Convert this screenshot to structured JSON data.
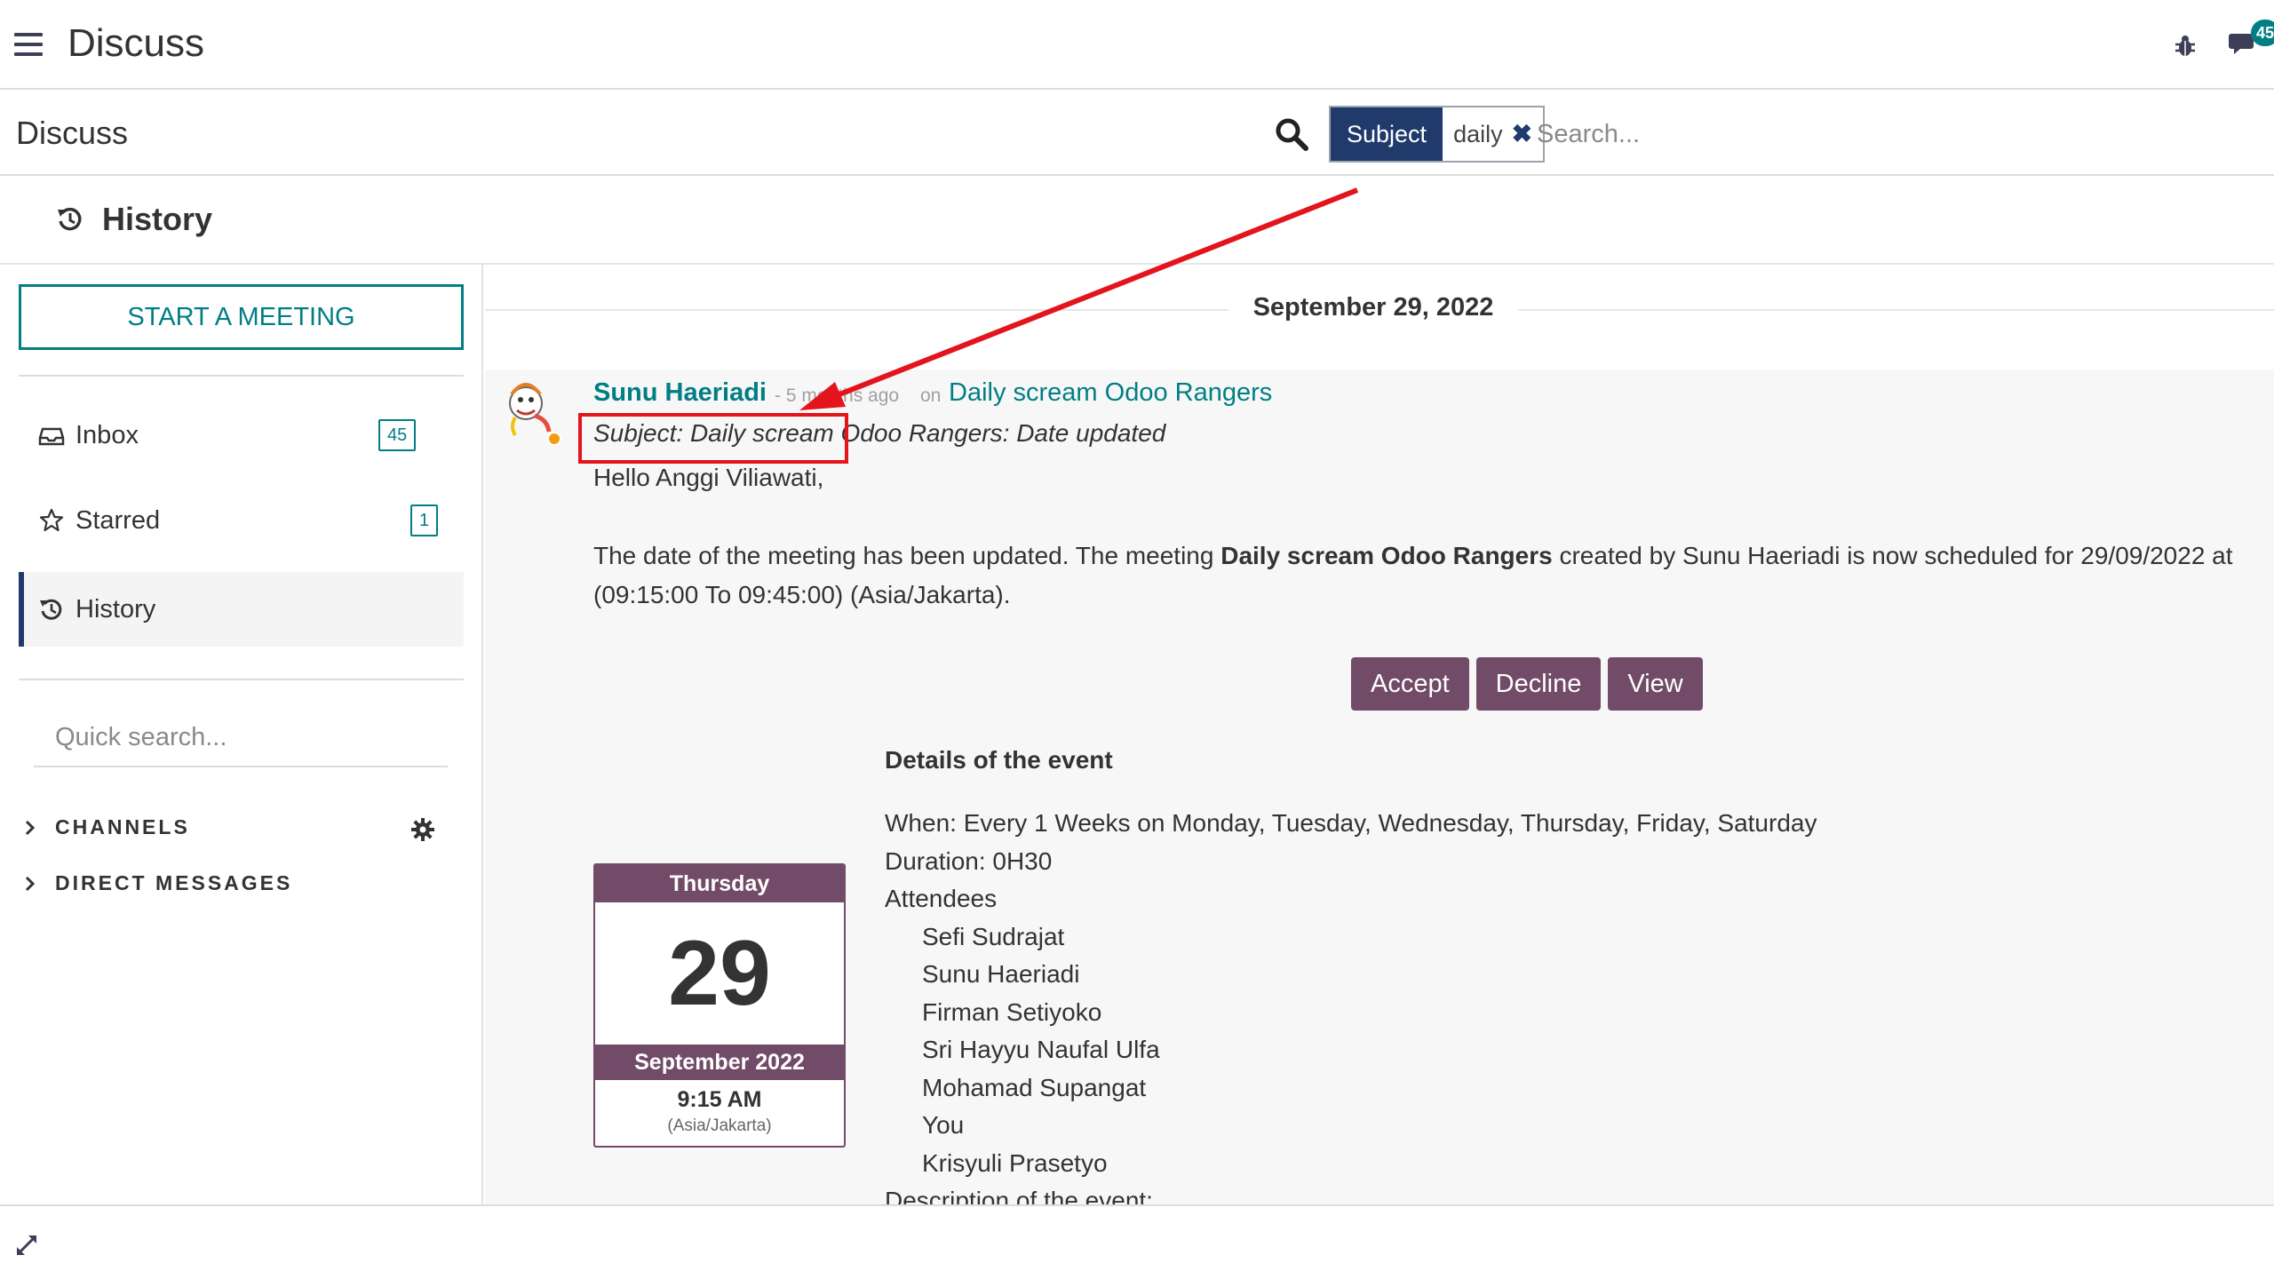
{
  "app": {
    "title": "Discuss",
    "chat_badge": "45"
  },
  "control": {
    "breadcrumb": "Discuss"
  },
  "search": {
    "facet_label": "Subject",
    "facet_value": "daily",
    "placeholder": "Search..."
  },
  "thread": {
    "title": "History"
  },
  "sidebar": {
    "start_meeting": "START A MEETING",
    "items": [
      {
        "label": "Inbox",
        "count": "45"
      },
      {
        "label": "Starred",
        "count": "1"
      },
      {
        "label": "History",
        "count": ""
      }
    ],
    "quick_search_placeholder": "Quick search...",
    "categories": [
      {
        "label": "CHANNELS"
      },
      {
        "label": "DIRECT MESSAGES"
      }
    ]
  },
  "message": {
    "date_separator": "September 29, 2022",
    "author": "Sunu Haeriadi",
    "date": "- 5 months ago",
    "on": "on",
    "record": "Daily scream Odoo Rangers",
    "subject": "Subject: Daily scream Odoo Rangers: Date updated",
    "greeting": "Hello Anggi Viliawati,",
    "body_pre": "The date of the meeting has been updated. The meeting ",
    "body_bold": "Daily scream Odoo Rangers",
    "body_post": " created by Sunu Haeriadi is now scheduled for 29/09/2022 at (09:15:00 To 09:45:00) (Asia/Jakarta).",
    "buttons": {
      "accept": "Accept",
      "decline": "Decline",
      "view": "View"
    },
    "details_title": "Details of the event",
    "when": "When: Every 1 Weeks on Monday, Tuesday, Wednesday, Thursday, Friday, Saturday",
    "duration": "Duration: 0H30",
    "attendees_label": "Attendees",
    "attendees": [
      "Sefi Sudrajat",
      "Sunu Haeriadi",
      "Firman Setiyoko",
      "Sri Hayyu Naufal Ulfa",
      "Mohamad Supangat",
      "You",
      "Krisyuli Prasetyo"
    ],
    "description_label": "Description of the event:",
    "calendar": {
      "weekday": "Thursday",
      "day": "29",
      "month_year": "September 2022",
      "time": "9:15 AM",
      "timezone": "(Asia/Jakarta)"
    }
  },
  "colors": {
    "primary": "#714b67",
    "teal": "#017e84",
    "facet": "#1f3a6b",
    "annotation": "#e3141b"
  },
  "icons": [
    "menu-icon",
    "bug-icon",
    "chat-icon",
    "search-icon",
    "remove-facet-icon",
    "history-icon",
    "inbox-icon",
    "star-icon",
    "chevron-right-icon",
    "gear-icon",
    "expand-icon",
    "avatar"
  ]
}
